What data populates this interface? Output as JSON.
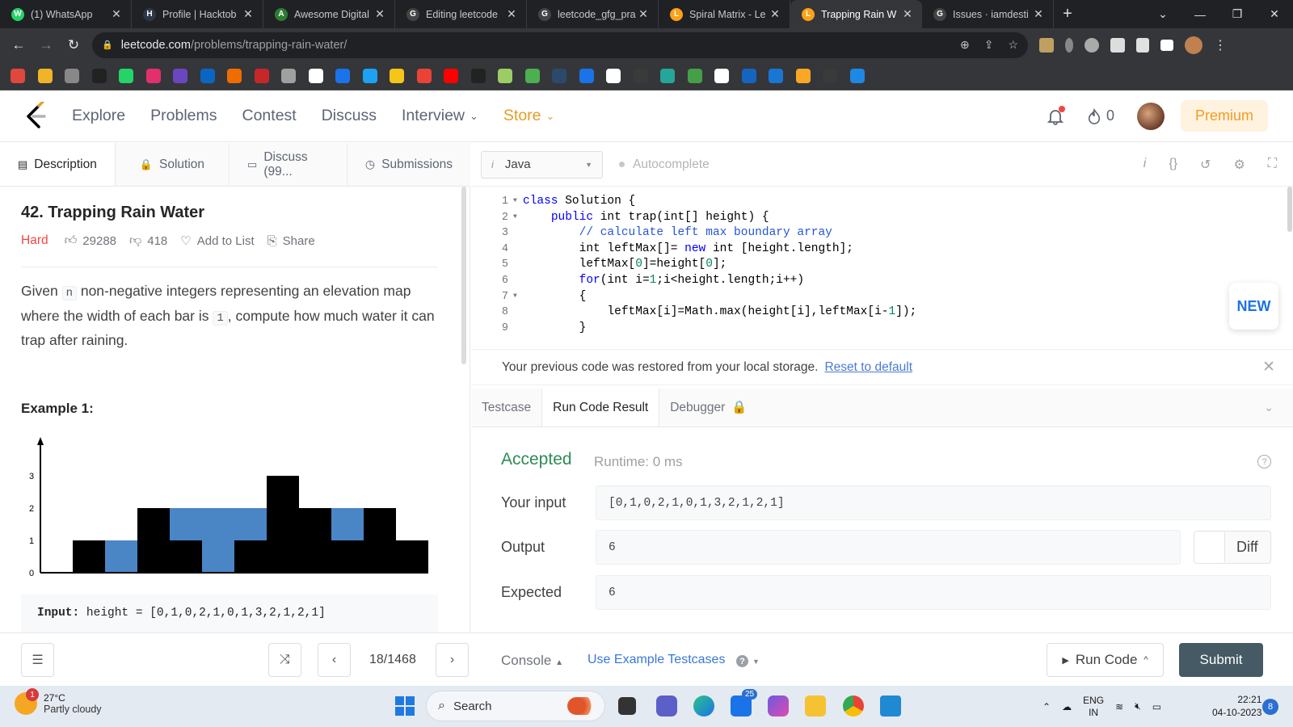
{
  "browser": {
    "tabs": [
      {
        "title": "(1) WhatsApp",
        "color": "#25d366",
        "glyph": "W"
      },
      {
        "title": "Profile | Hacktob",
        "color": "#2d3748",
        "glyph": "H"
      },
      {
        "title": "Awesome Digital",
        "color": "#2e7d32",
        "glyph": "A"
      },
      {
        "title": "Editing leetcode",
        "color": "#444",
        "glyph": "G"
      },
      {
        "title": "leetcode_gfg_pra",
        "color": "#444",
        "glyph": "G"
      },
      {
        "title": "Spiral Matrix - Le",
        "color": "#ffa116",
        "glyph": "L"
      },
      {
        "title": "Trapping Rain W",
        "color": "#ffa116",
        "glyph": "L",
        "active": true
      },
      {
        "title": "Issues · iamdesti",
        "color": "#444",
        "glyph": "G"
      }
    ],
    "new_tab": "+",
    "url_host": "leetcode.com",
    "url_path": "/problems/trapping-rain-water/"
  },
  "nav": {
    "links": [
      "Explore",
      "Problems",
      "Contest",
      "Discuss",
      "Interview",
      "Store"
    ],
    "streak": "0",
    "premium": "Premium"
  },
  "left_tabs": {
    "description": "Description",
    "solution": "Solution",
    "discuss": "Discuss (99...",
    "submissions": "Submissions"
  },
  "problem": {
    "title": "42. Trapping Rain Water",
    "difficulty": "Hard",
    "likes": "29288",
    "dislikes": "418",
    "add_to_list": "Add to List",
    "share": "Share",
    "desc_1": "Given ",
    "desc_n": "n",
    "desc_2": " non-negative integers representing an elevation map where the width of each bar is ",
    "desc_one": "1",
    "desc_3": ", compute how much water it can trap after raining.",
    "example_title": "Example 1:",
    "example_input_label": "Input:",
    "example_input_value": " height = [0,1,0,2,1,0,1,3,2,1,2,1]"
  },
  "chart_data": {
    "type": "bar",
    "x": [
      0,
      1,
      2,
      3,
      4,
      5,
      6,
      7,
      8,
      9,
      10,
      11
    ],
    "series": [
      {
        "values": [
          0,
          1,
          0,
          2,
          1,
          0,
          1,
          3,
          2,
          1,
          2,
          1
        ],
        "color": "#000000"
      },
      {
        "values": [
          0,
          0,
          1,
          0,
          1,
          2,
          1,
          0,
          0,
          1,
          0,
          0
        ],
        "color": "#4a85c5"
      }
    ],
    "yticks": [
      "0",
      "1",
      "2",
      "3"
    ],
    "ylim": [
      0,
      3
    ]
  },
  "editor": {
    "language": "Java",
    "autocomplete": "Autocomplete",
    "lines": [
      {
        "n": "1",
        "fold": true,
        "tokens": [
          [
            "kw",
            "class"
          ],
          [
            "cd",
            " Solution {"
          ]
        ]
      },
      {
        "n": "2",
        "fold": true,
        "tokens": [
          [
            "cd",
            "    "
          ],
          [
            "kw",
            "public"
          ],
          [
            "cd",
            " int trap(int[] height) {"
          ]
        ]
      },
      {
        "n": "3",
        "tokens": [
          [
            "cd",
            "        "
          ],
          [
            "cm",
            "// calculate left max boundary array"
          ]
        ]
      },
      {
        "n": "4",
        "tokens": [
          [
            "cd",
            "        int leftMax[]= "
          ],
          [
            "kw",
            "new"
          ],
          [
            "cd",
            " int [height.length];"
          ]
        ]
      },
      {
        "n": "5",
        "tokens": [
          [
            "cd",
            "        leftMax["
          ],
          [
            "num",
            "0"
          ],
          [
            "cd",
            "]=height["
          ],
          [
            "num",
            "0"
          ],
          [
            "cd",
            "];"
          ]
        ]
      },
      {
        "n": "6",
        "tokens": [
          [
            "cd",
            "        "
          ],
          [
            "kw",
            "for"
          ],
          [
            "cd",
            "(int i="
          ],
          [
            "num",
            "1"
          ],
          [
            "cd",
            ";i<height.length;i++)"
          ]
        ]
      },
      {
        "n": "7",
        "fold": true,
        "tokens": [
          [
            "cd",
            "        {"
          ]
        ]
      },
      {
        "n": "8",
        "tokens": [
          [
            "cd",
            "            leftMax[i]=Math.max(height[i],leftMax[i-"
          ],
          [
            "num",
            "1"
          ],
          [
            "cd",
            "]);"
          ]
        ]
      },
      {
        "n": "9",
        "tokens": [
          [
            "cd",
            "        }"
          ]
        ]
      }
    ],
    "new_badge": "NEW"
  },
  "restore": {
    "message": "Your previous code was restored from your local storage.",
    "reset": "Reset to default"
  },
  "result_tabs": {
    "testcase": "Testcase",
    "run_result": "Run Code Result",
    "debugger": "Debugger"
  },
  "result": {
    "status": "Accepted",
    "runtime": "Runtime: 0 ms",
    "input_label": "Your input",
    "input_value": "[0,1,0,2,1,0,1,3,2,1,2,1]",
    "output_label": "Output",
    "output_value": "6",
    "expected_label": "Expected",
    "expected_value": "6",
    "diff": "Diff"
  },
  "bottom": {
    "page": "18/1468",
    "console": "Console",
    "use_example": "Use Example Testcases",
    "run_code": "Run Code",
    "submit": "Submit"
  },
  "taskbar": {
    "temp": "27°C",
    "weather": "Partly cloudy",
    "weather_badge": "1",
    "search": "Search",
    "mail_badge": "25",
    "lang_1": "ENG",
    "lang_2": "IN",
    "time": "22:21",
    "date": "04-10-2023",
    "notif": "8"
  }
}
